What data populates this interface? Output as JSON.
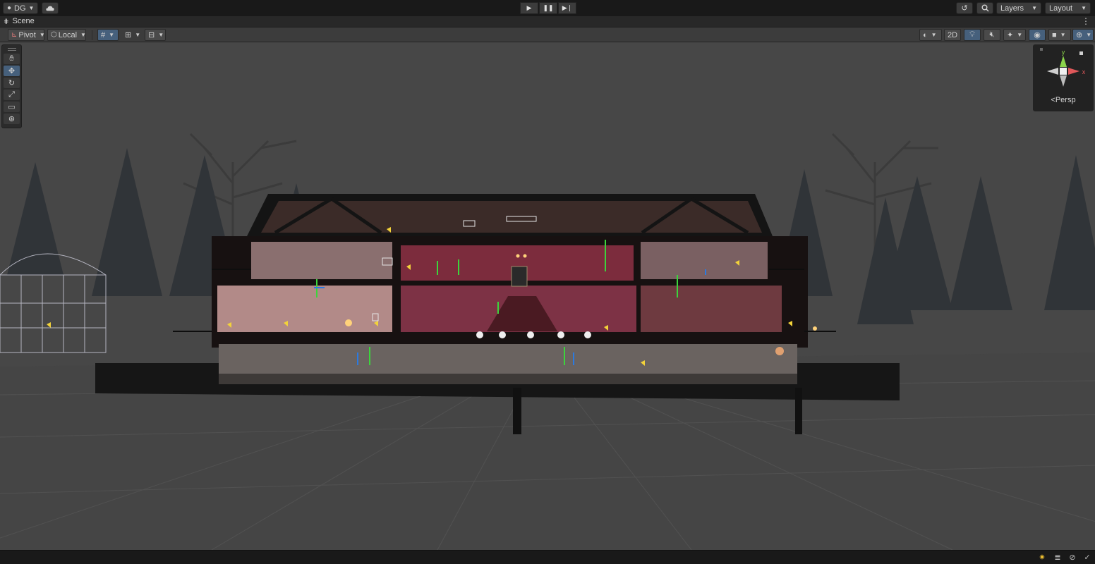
{
  "topbar": {
    "account_label": "DG",
    "cloud_icon": "cloud-icon",
    "play_icon": "play-icon",
    "pause_icon": "pause-icon",
    "step_icon": "step-icon",
    "history_icon": "history-icon",
    "search_icon": "search-icon",
    "layers_label": "Layers",
    "layout_label": "Layout"
  },
  "scene_tab": {
    "label": "Scene"
  },
  "scene_toolbar": {
    "pivot_label": "Pivot",
    "local_label": "Local",
    "mode_2d_label": "2D"
  },
  "tools": [
    "hand-icon",
    "move-icon",
    "rotate-icon",
    "scale-icon",
    "rect-icon",
    "transform-icon"
  ],
  "gizmo": {
    "projection_label": "Persp",
    "axis_y": "y",
    "axis_x": "x"
  },
  "colors": {
    "active_blue": "#46607c",
    "viewport_bg": "#474747",
    "gizmo_y": "#8bd34a",
    "gizmo_x": "#e0585a"
  }
}
